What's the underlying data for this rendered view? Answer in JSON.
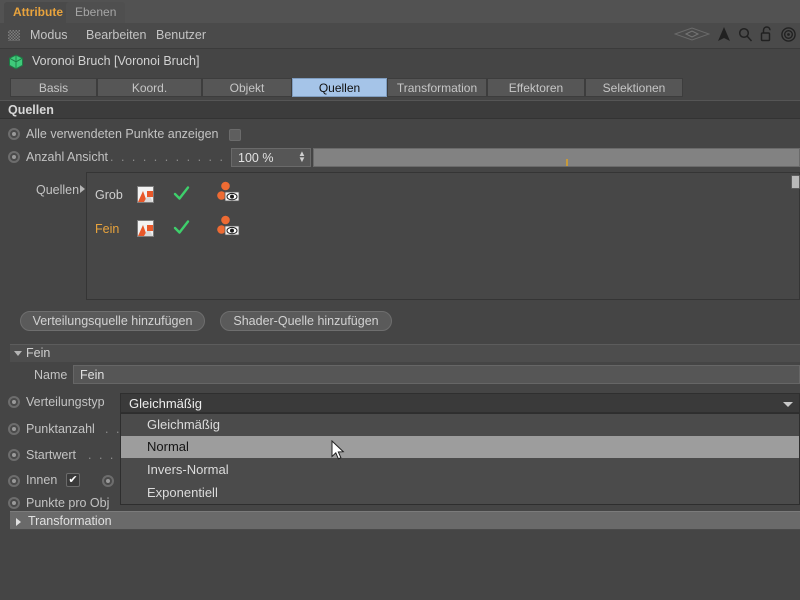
{
  "manager_tabs": [
    {
      "label": "Attribute",
      "active": true
    },
    {
      "label": "Ebenen",
      "active": false
    }
  ],
  "menu": {
    "grip_icon": "drag-grip-icon",
    "items": [
      "Modus",
      "Bearbeiten",
      "Benutzer"
    ],
    "tool_icons": [
      "mesh-diamond-icon",
      "arrow-pointer-icon",
      "search-icon",
      "unlock-icon",
      "target-icon"
    ]
  },
  "object": {
    "icon": "voronoi-fracture-icon",
    "title": "Voronoi Bruch [Voronoi Bruch]"
  },
  "property_tabs": [
    {
      "label": "Basis",
      "selected": false
    },
    {
      "label": "Koord.",
      "selected": false
    },
    {
      "label": "Objekt",
      "selected": false
    },
    {
      "label": "Quellen",
      "selected": true
    },
    {
      "label": "Transformation",
      "selected": false
    },
    {
      "label": "Effektoren",
      "selected": false
    },
    {
      "label": "Selektionen",
      "selected": false
    }
  ],
  "sources_section": {
    "band_title": "Quellen",
    "show_all_points": {
      "label": "Alle verwendeten Punkte anzeigen",
      "checked": false
    },
    "count_view": {
      "label": "Anzahl Ansicht",
      "dots": ". . . . . . . . . . . . . . . . . .",
      "value": "100 %",
      "slider_tick_percent": 45
    },
    "list_label": "Quellen",
    "list_items": [
      {
        "name": "Grob",
        "highlighted": false,
        "thumb_icon": "shader-thumbnail-icon",
        "enabled_icon": "green-check-icon",
        "visibility_icon": "points-eye-icon"
      },
      {
        "name": "Fein",
        "highlighted": true,
        "thumb_icon": "shader-thumbnail-icon",
        "enabled_icon": "green-check-icon",
        "visibility_icon": "points-eye-icon"
      }
    ],
    "buttons": [
      "Verteilungsquelle hinzufügen",
      "Shader-Quelle hinzufügen"
    ]
  },
  "fein_group": {
    "title": "Fein",
    "expanded": true,
    "name_label": "Name",
    "name_value": "Fein",
    "distribution": {
      "label": "Verteilungstyp",
      "value": "Gleichmäßig",
      "options": [
        {
          "label": "Gleichmäßig",
          "hover": false
        },
        {
          "label": "Normal",
          "hover": true
        },
        {
          "label": "Invers-Normal",
          "hover": false
        },
        {
          "label": "Exponentiell",
          "hover": false
        }
      ]
    },
    "rows": [
      {
        "label": "Punktanzahl",
        "dots": ". ."
      },
      {
        "label": "Startwert",
        "dots": ". . . . ."
      },
      {
        "label": "Innen",
        "checkbox": true
      },
      {
        "label": "Punkte pro Obj",
        "dots": ""
      }
    ]
  },
  "transformation_group": {
    "title": "Transformation",
    "expanded": false
  },
  "colors": {
    "background": "#454545",
    "accent_orange": "#e8a33d",
    "tab_selected": "#a5c4e8",
    "hover_row": "#9d9d9d",
    "check_green": "#3ecf6b",
    "point_orange": "#ee6b33"
  }
}
